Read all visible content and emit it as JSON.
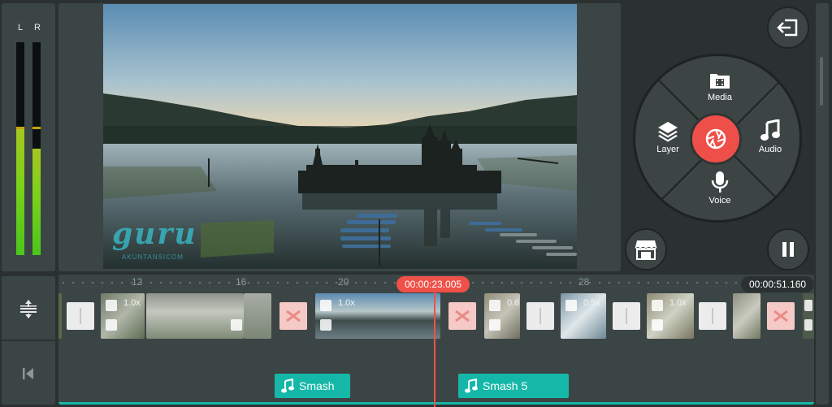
{
  "meter": {
    "left_label": "L",
    "right_label": "R",
    "left_level": 0.59,
    "right_level": 0.5
  },
  "preview": {
    "watermark": "guru",
    "watermark_sub": "AKUNTANSICOM"
  },
  "menu": {
    "media_label": "Media",
    "layer_label": "Layer",
    "audio_label": "Audio",
    "voice_label": "Voice"
  },
  "timeline": {
    "current_time": "00:00:23.005",
    "total_time": "00:00:51.160",
    "ruler_labels": [
      "12",
      "16",
      "20",
      "28"
    ],
    "clip_speeds": [
      "1.0x",
      "1.0x",
      "0.6",
      "0.5x",
      "1.0x"
    ]
  },
  "audio_tracks": [
    {
      "label": "Smash"
    },
    {
      "label": "Smash 5"
    }
  ],
  "colors": {
    "accent": "#ef4f49",
    "audio": "#15b8a8",
    "panel": "#3c4545"
  }
}
